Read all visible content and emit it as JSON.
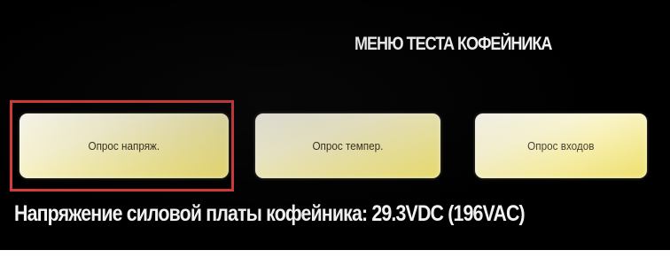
{
  "screen": {
    "title": "МЕНЮ ТЕСТА КОФЕЙНИКА"
  },
  "buttons": [
    {
      "label": "Опрос напряж.",
      "selected": true
    },
    {
      "label": "Опрос темпер.",
      "selected": false
    },
    {
      "label": "Опрос входов",
      "selected": false
    }
  ],
  "status": {
    "text": "Напряжение силовой платы кофейника: 29.3VDC (196VAC)"
  },
  "colors": {
    "background": "#000000",
    "button_light": "#fffdf2",
    "button_dark": "#eedf6e",
    "selection_frame": "#d63a3a",
    "text": "#f5f5f5"
  }
}
